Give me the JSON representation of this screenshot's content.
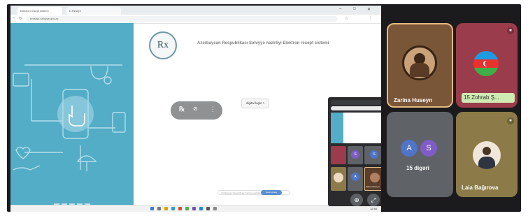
{
  "browser": {
    "tabs": [
      "Elektron resept sistemi",
      "E-Resept"
    ],
    "url": "eresept.sehiyye.gov.az"
  },
  "site": {
    "logo_text": "Rx",
    "title": "Azərbaycan Respublikası Səhiyyə nazirliyi Elektron resept sistemi",
    "login_button": "digital login >",
    "bottom_hint": "Azərbaycan Respublikası Səhiyyə nazirliyi",
    "bottom_button": "Daxil olmaq"
  },
  "presentation_bar": {
    "icons": [
      "rx-icon",
      "camera-off-icon",
      "more-vert-icon"
    ]
  },
  "taskbar": {
    "time": "12:45"
  },
  "mini_preview": {
    "participant_label": "Zarina Huseyn",
    "controls": [
      "zoom-in-icon",
      "expand-icon"
    ]
  },
  "participants": [
    {
      "name": "Zarina Huseyn",
      "type": "photo"
    },
    {
      "name": "15 Zohrab Ş...",
      "type": "flag"
    },
    {
      "name": "15 digəri",
      "type": "group",
      "initials": [
        "A",
        "S"
      ]
    },
    {
      "name": "Laia Bağırova",
      "type": "photo"
    }
  ],
  "colors": {
    "panel_blue": "#53adc7",
    "highlight_border": "#e4ba7e",
    "tile_maroon": "#9b3c4c",
    "tile_grey": "#5f6368",
    "tile_olive": "#8c7b49",
    "avatar_blue": "#4f74c8",
    "avatar_purple": "#7f5cc6"
  }
}
